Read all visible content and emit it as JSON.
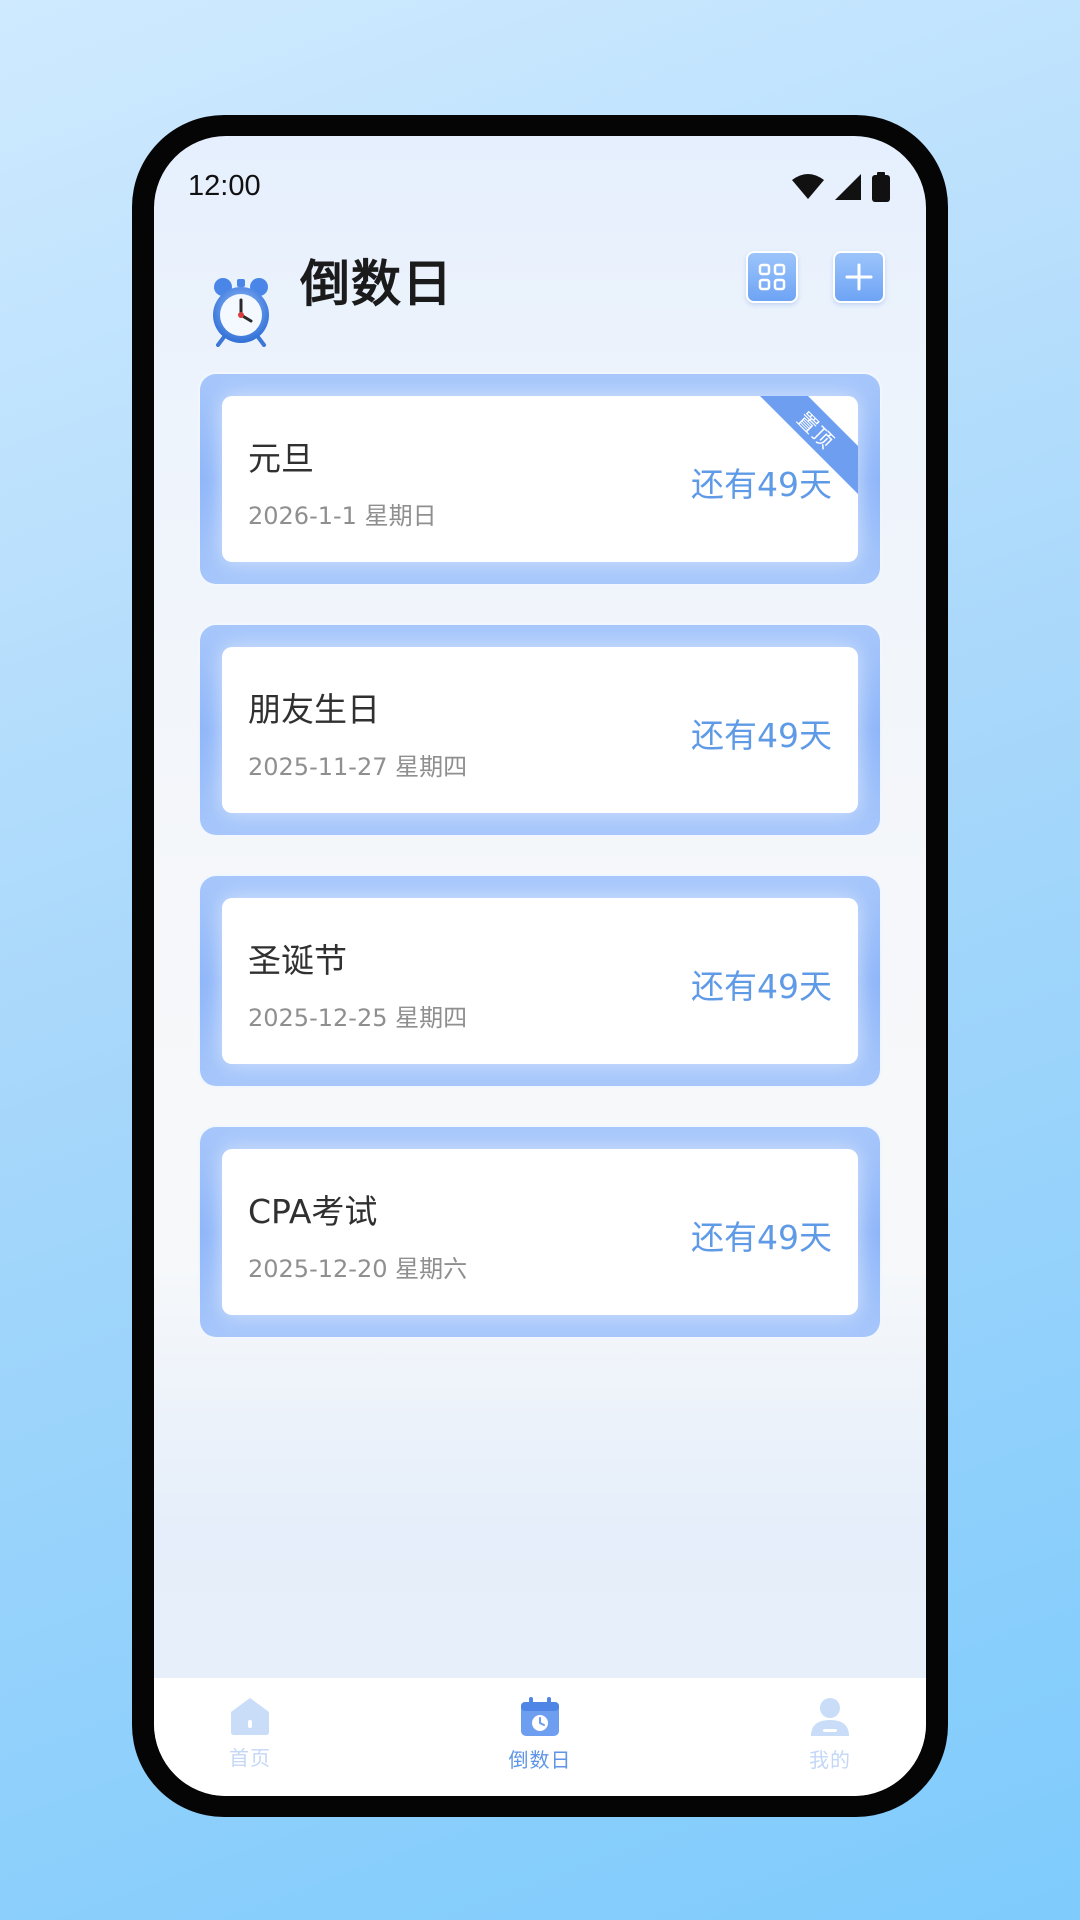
{
  "status_bar": {
    "time": "12:00",
    "icons": [
      "wifi-icon",
      "signal-icon",
      "battery-icon"
    ]
  },
  "header": {
    "title": "倒数日",
    "app_icon": "alarm-clock-icon",
    "actions": [
      "grid-view-icon",
      "add-icon"
    ]
  },
  "events": [
    {
      "title": "元旦",
      "date": "2026-1-1 星期日",
      "days_left": "还有49天",
      "pinned": true,
      "pin_label": "置顶"
    },
    {
      "title": "朋友生日",
      "date": "2025-11-27 星期四",
      "days_left": "还有49天",
      "pinned": false
    },
    {
      "title": "圣诞节",
      "date": "2025-12-25 星期四",
      "days_left": "还有49天",
      "pinned": false
    },
    {
      "title": "CPA考试",
      "date": "2025-12-20 星期六",
      "days_left": "还有49天",
      "pinned": false
    }
  ],
  "bottom_nav": {
    "items": [
      {
        "label": "首页",
        "icon": "home-icon",
        "active": false
      },
      {
        "label": "倒数日",
        "icon": "calendar-clock-icon",
        "active": true
      },
      {
        "label": "我的",
        "icon": "user-icon",
        "active": false
      }
    ]
  },
  "colors": {
    "accent": "#5f9ae6",
    "card_frame": "#8fb6f9",
    "nav_inactive": "#c3d7f6"
  }
}
